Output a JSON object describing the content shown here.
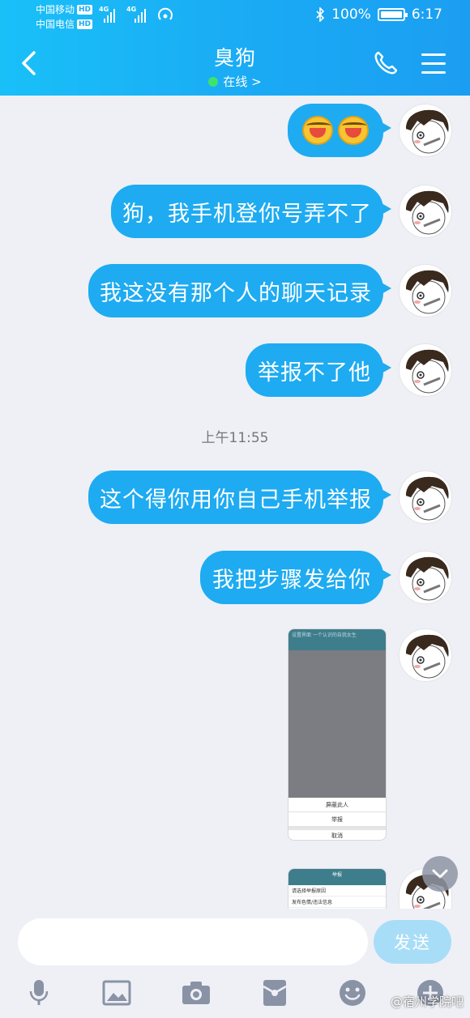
{
  "status_bar": {
    "carrier1": "中国移动",
    "carrier2": "中国电信",
    "hd": "HD",
    "net1": "4G",
    "net2": "4G",
    "battery": "100%",
    "battery_level": 1.0,
    "time": "6:17"
  },
  "header": {
    "contact_name": "臭狗",
    "status": "在线 >"
  },
  "messages": [
    {
      "type": "emoji",
      "content": [
        "face-with-tears-emoji",
        "face-with-tears-emoji"
      ]
    },
    {
      "type": "text",
      "text": "狗，我手机登你号弄不了"
    },
    {
      "type": "text",
      "text": "我这没有那个人的聊天记录"
    },
    {
      "type": "text",
      "text": "举报不了他"
    },
    {
      "type": "time",
      "text": "上午11:55"
    },
    {
      "type": "text",
      "text": "这个得你用你自己手机举报"
    },
    {
      "type": "text",
      "text": "我把步骤发给你"
    }
  ],
  "screenshot1": {
    "top_text": "设置界面  一个认识的自我女生",
    "rows": [
      "屏蔽此人",
      "举报",
      "取消"
    ]
  },
  "screenshot2": {
    "top_text": "举报",
    "lines": [
      "请选择举报原因",
      "发布色情/违法信息"
    ]
  },
  "input": {
    "placeholder": "",
    "send_label": "发送"
  },
  "toolbar": [
    "microphone-icon",
    "image-icon",
    "camera-icon",
    "red-packet-icon",
    "emoji-icon",
    "plus-icon"
  ],
  "watermark": "@宿州学院吧",
  "colors": {
    "header": "#1aaaf4",
    "bubble": "#1eabf1",
    "background": "#eef0f6",
    "send_disabled": "#a8ddf7",
    "online": "#3ee36b"
  }
}
